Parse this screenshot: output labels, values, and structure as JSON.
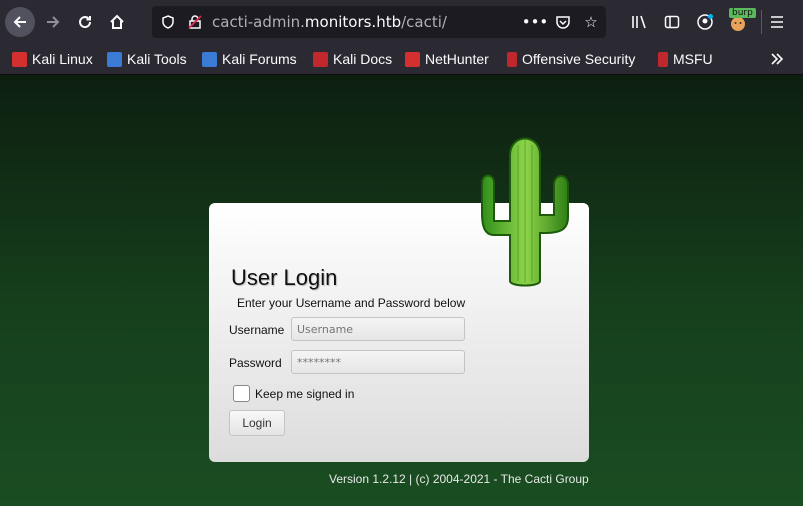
{
  "browser": {
    "url_prefix": "cacti-admin.",
    "url_host": "monitors.htb",
    "url_path": "/cacti/",
    "burp_label": "burp"
  },
  "bookmarks": [
    {
      "label": "Kali Linux",
      "color": "#d43030"
    },
    {
      "label": "Kali Tools",
      "color": "#3a7bd5"
    },
    {
      "label": "Kali Forums",
      "color": "#3a7bd5"
    },
    {
      "label": "Kali Docs",
      "color": "#c0282d"
    },
    {
      "label": "NetHunter",
      "color": "#d43030"
    },
    {
      "label": "Offensive Security",
      "color": "#c0282d"
    },
    {
      "label": "MSFU",
      "color": "#c0282d"
    }
  ],
  "login": {
    "title": "User Login",
    "subtitle": "Enter your Username and Password below",
    "username_label": "Username",
    "username_placeholder": "Username",
    "password_label": "Password",
    "password_placeholder": "********",
    "remember_label": "Keep me signed in",
    "button_label": "Login"
  },
  "footer": {
    "version": "Version 1.2.12 | (c) 2004-2021 - The Cacti Group"
  }
}
